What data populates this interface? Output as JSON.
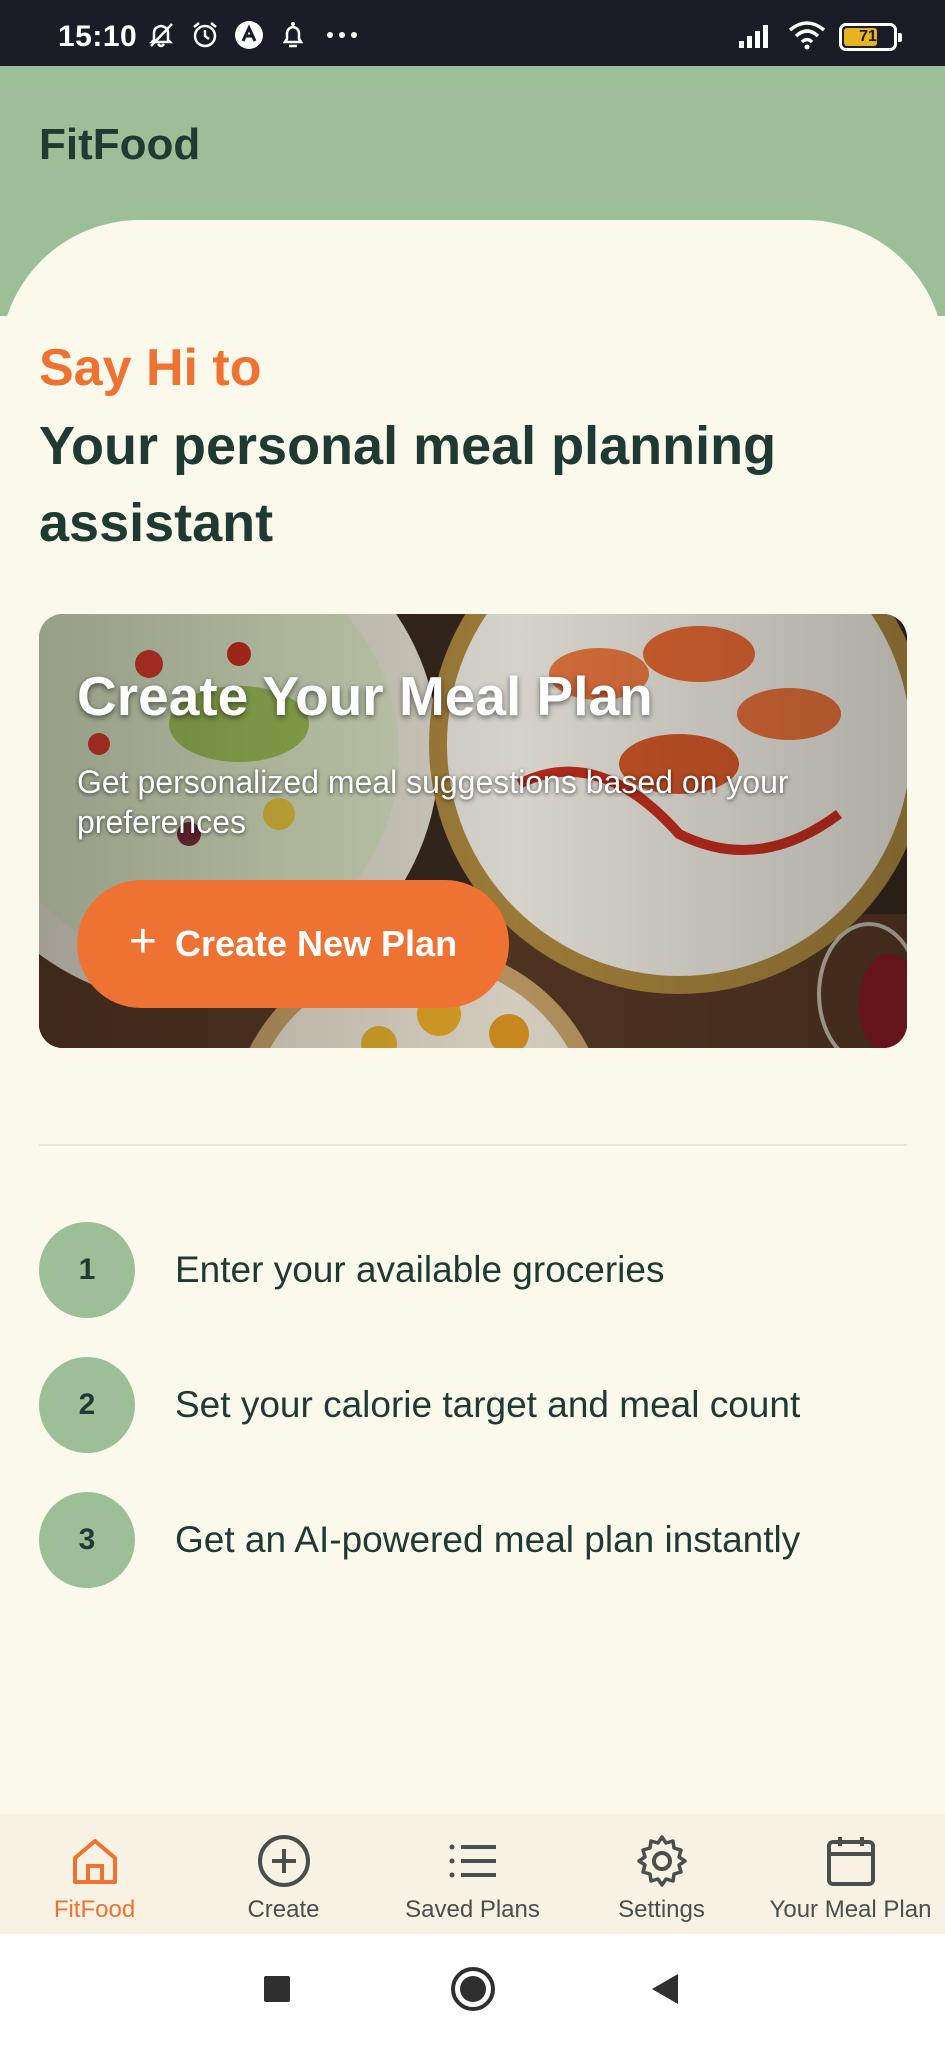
{
  "status_bar": {
    "time": "15:10",
    "left_icons": [
      "notifications-off-icon",
      "alarm-icon",
      "app-a-icon",
      "bell-icon",
      "more-dots-icon"
    ],
    "right_icons": [
      "signal-icon",
      "wifi-icon",
      "battery-icon"
    ],
    "battery_level": "71",
    "battery_fraction": 0.71
  },
  "header": {
    "title": "FitFood"
  },
  "main": {
    "greeting": "Say Hi to",
    "headline": "Your personal meal planning assistant",
    "hero": {
      "title": "Create Your Meal Plan",
      "subtitle": "Get personalized meal suggestions based on your preferences",
      "button_label": "Create New Plan",
      "button_icon": "plus-icon"
    },
    "steps": [
      {
        "number": "1",
        "text": "Enter your available groceries"
      },
      {
        "number": "2",
        "text": "Set your calorie target and meal count"
      },
      {
        "number": "3",
        "text": "Get an AI-powered meal plan instantly"
      }
    ]
  },
  "bottom_nav": {
    "items": [
      {
        "label": "FitFood",
        "icon": "home-icon",
        "active": true
      },
      {
        "label": "Create",
        "icon": "plus-circle-icon",
        "active": false
      },
      {
        "label": "Saved Plans",
        "icon": "list-icon",
        "active": false
      },
      {
        "label": "Settings",
        "icon": "gear-icon",
        "active": false
      },
      {
        "label": "Your Meal Plan",
        "icon": "calendar-icon",
        "active": false
      }
    ]
  },
  "system_nav": [
    "recents-icon",
    "home-circle-icon",
    "back-icon"
  ],
  "colors": {
    "accent": "#ee7332",
    "header_green": "#9dbf98",
    "dark_text": "#1e3a33",
    "background": "#fbf8ec"
  }
}
